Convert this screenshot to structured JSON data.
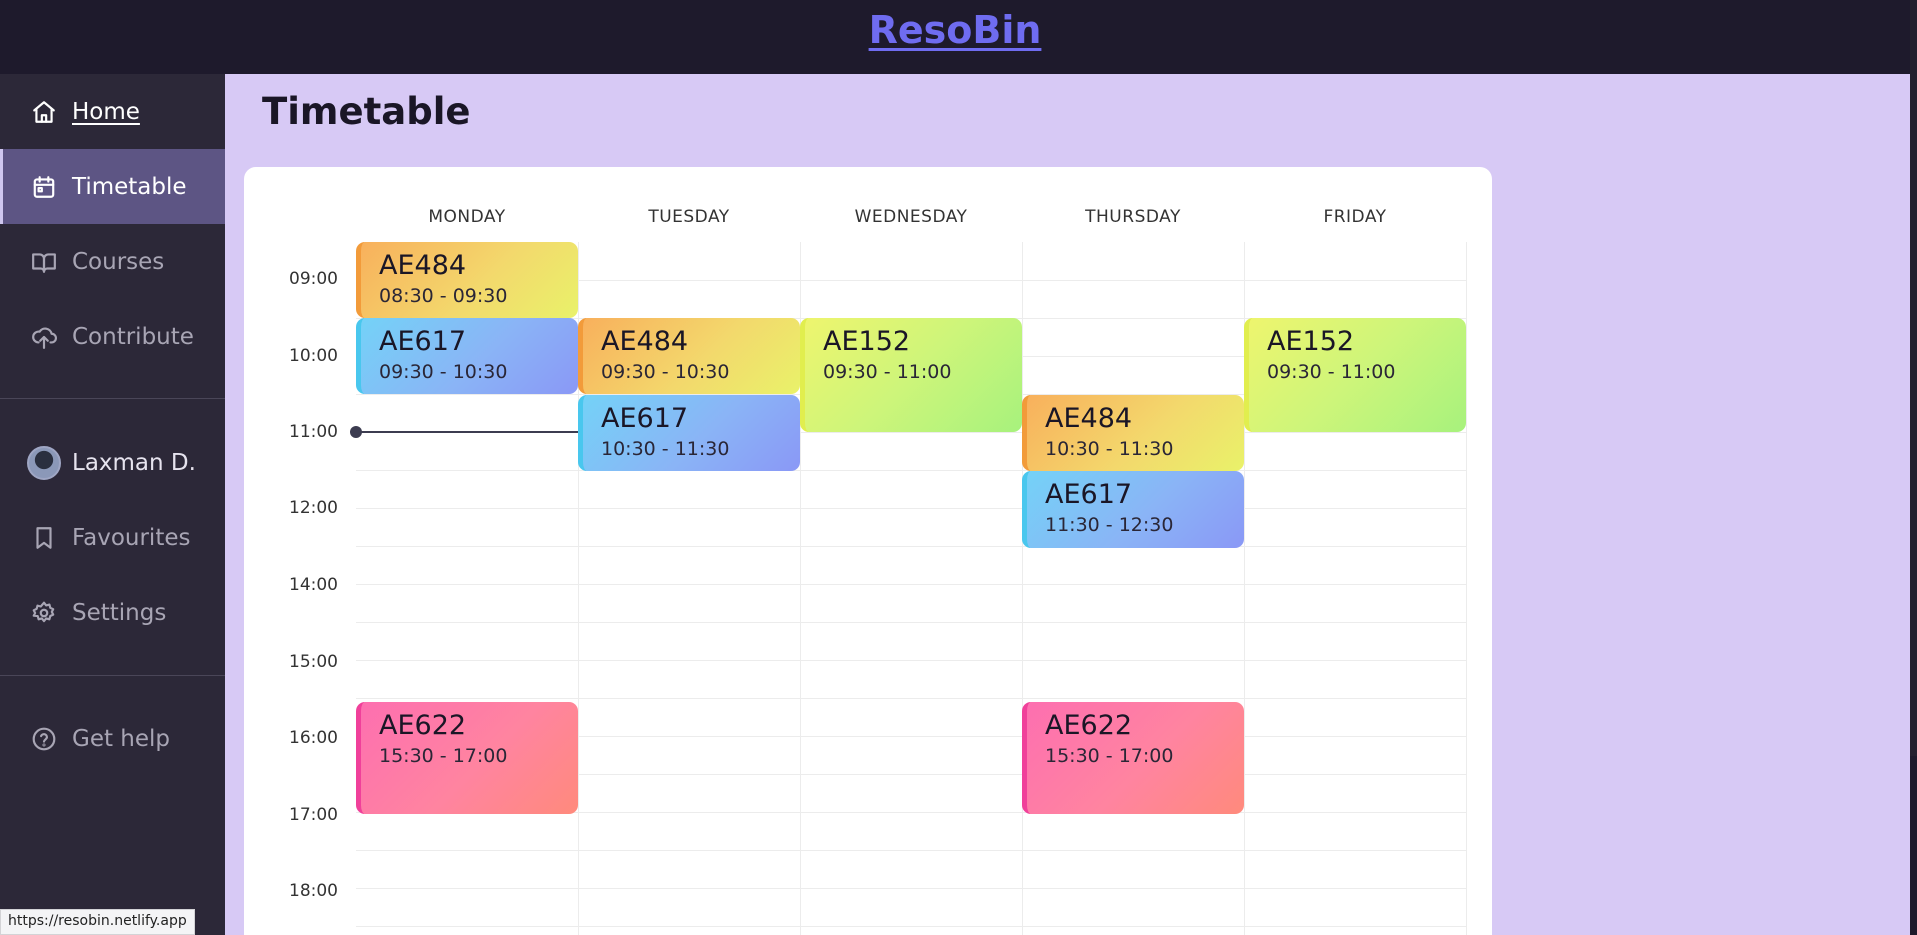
{
  "header": {
    "brand": "ResoBin"
  },
  "sidebar": {
    "items": [
      {
        "label": "Home",
        "icon": "home-icon"
      },
      {
        "label": "Timetable",
        "icon": "calendar-icon"
      },
      {
        "label": "Courses",
        "icon": "book-icon"
      },
      {
        "label": "Contribute",
        "icon": "cloud-upload-icon"
      }
    ],
    "user": {
      "name": "Laxman D."
    },
    "secondary": [
      {
        "label": "Favourites",
        "icon": "bookmark-icon"
      },
      {
        "label": "Settings",
        "icon": "gear-icon"
      }
    ],
    "help": {
      "label": "Get help",
      "icon": "help-circle-icon"
    }
  },
  "main": {
    "title": "Timetable"
  },
  "timetable": {
    "days": [
      "MONDAY",
      "TUESDAY",
      "WEDNESDAY",
      "THURSDAY",
      "FRIDAY"
    ],
    "times": [
      "09:00",
      "10:00",
      "11:00",
      "12:00",
      "14:00",
      "15:00",
      "16:00",
      "17:00",
      "18:00"
    ],
    "events": [
      {
        "code": "AE484",
        "time": "08:30 - 09:30",
        "day": "MONDAY"
      },
      {
        "code": "AE617",
        "time": "09:30 - 10:30",
        "day": "MONDAY"
      },
      {
        "code": "AE622",
        "time": "15:30 - 17:00",
        "day": "MONDAY"
      },
      {
        "code": "AE484",
        "time": "09:30 - 10:30",
        "day": "TUESDAY"
      },
      {
        "code": "AE617",
        "time": "10:30 - 11:30",
        "day": "TUESDAY"
      },
      {
        "code": "AE152",
        "time": "09:30 - 11:00",
        "day": "WEDNESDAY"
      },
      {
        "code": "AE484",
        "time": "10:30 - 11:30",
        "day": "THURSDAY"
      },
      {
        "code": "AE617",
        "time": "11:30 - 12:30",
        "day": "THURSDAY"
      },
      {
        "code": "AE622",
        "time": "15:30 - 17:00",
        "day": "THURSDAY"
      },
      {
        "code": "AE152",
        "time": "09:30 - 11:00",
        "day": "FRIDAY"
      }
    ]
  },
  "status_bar": {
    "url": "https://resobin.netlify.app"
  },
  "colors": {
    "brand": "#6f6cf0",
    "sidebar": "#2c2838",
    "active": "#5d5584",
    "page_bg": "#d7c9f5"
  }
}
